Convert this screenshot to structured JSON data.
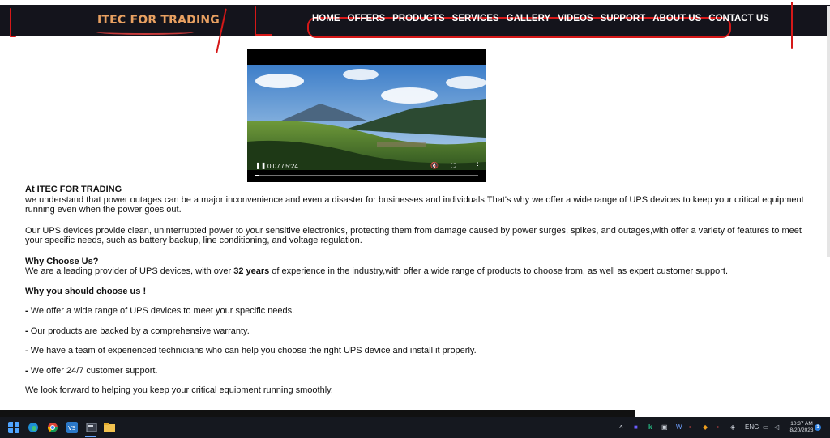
{
  "navbar": {
    "brand": "ITEC FOR TRADING",
    "items": [
      "HOME",
      "OFFERS",
      "PRODUCTS",
      "SERVICES",
      "GALLERY",
      "VIDEOS",
      "SUPPORT",
      "ABOUT US",
      "CONTACT US"
    ],
    "background": "#14141c",
    "brand_color": "#e8a061",
    "annotation_color": "#d51818"
  },
  "video": {
    "time": "0:07 / 5:24",
    "progress": 0.02
  },
  "content": {
    "intro_heading": "At ITEC FOR TRADING",
    "intro_text": "we understand that power outages can be a major inconvenience and even a disaster for businesses and individuals.That's why we offer a wide range of UPS devices to keep your critical equipment running even when the power goes out.",
    "features_text": "Our UPS devices provide clean, uninterrupted power to your sensitive electronics, protecting them from damage caused by power surges, spikes, and outages,with offer a variety of features to meet your specific needs, such as battery backup, line conditioning, and voltage regulation.",
    "why_heading": "Why Choose Us?",
    "why_text_before": "We are a leading provider of UPS devices, with over ",
    "why_years": "32 years",
    "why_text_after": " of experience in the industry,with offer a wide range of products to choose from, as well as expert customer support.",
    "reasons_heading": "Why you should choose us !",
    "bullets": [
      "We offer a wide range of UPS devices to meet your specific needs.",
      "Our products are backed by a comprehensive warranty.",
      "We have a team of experienced technicians who can help you choose the right UPS device and install it properly.",
      "We offer 24/7 customer support."
    ],
    "bullet_mark": "-",
    "closing": "We look forward to helping you keep your critical equipment running smoothly."
  },
  "taskbar": {
    "language": "ENG",
    "time": "10:37 AM",
    "date": "8/20/2023",
    "notifications": "1",
    "background": "#15181f"
  }
}
